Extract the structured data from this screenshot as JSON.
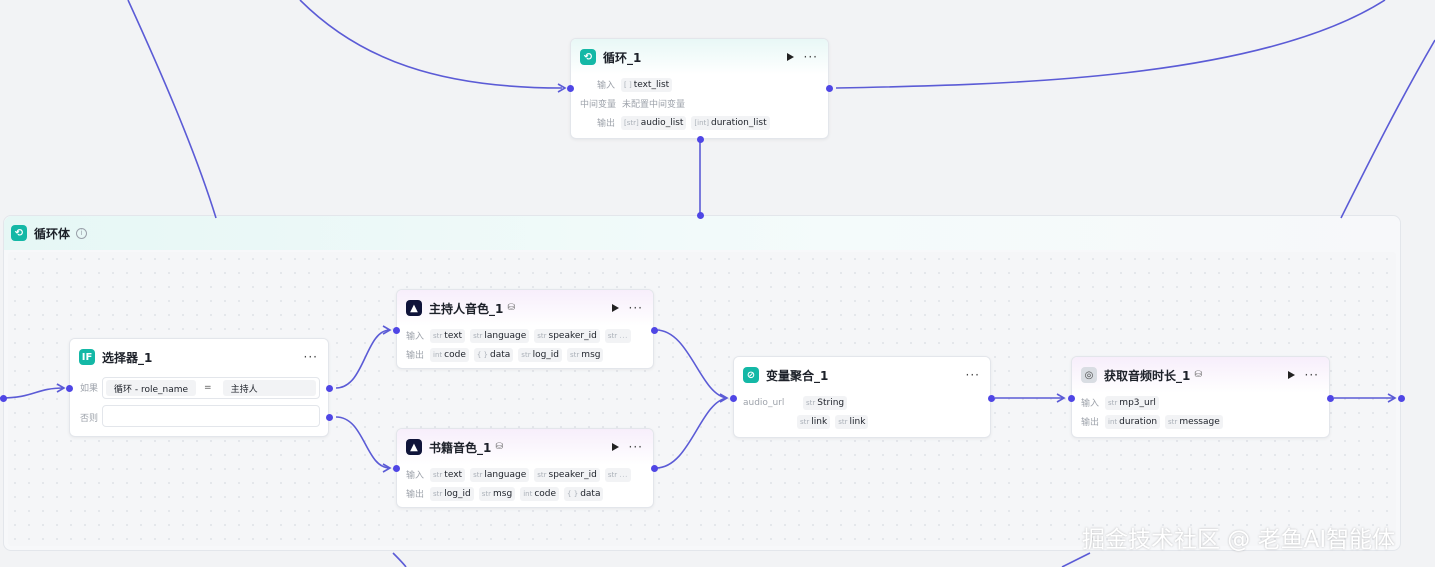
{
  "loop_node": {
    "title": "循环_1",
    "input_label": "输入",
    "input_type": "[ ]",
    "input_value": "text_list",
    "mid_label": "中间变量",
    "mid_value": "未配置中间变量",
    "output_label": "输出",
    "outputs": [
      {
        "type": "[str]",
        "name": "audio_list"
      },
      {
        "type": "[int]",
        "name": "duration_list"
      }
    ]
  },
  "loop_body": {
    "title": "循环体",
    "info_icon": "info-icon"
  },
  "selector_node": {
    "title": "选择器_1",
    "icon_text": "IF",
    "if_label": "如果",
    "cond_left": "循环 - role_name",
    "cond_op": "=",
    "cond_right": "主持人",
    "else_label": "否则"
  },
  "host_voice_node": {
    "title": "主持人音色_1",
    "input_label": "输入",
    "inputs": [
      {
        "type": "str",
        "name": "text"
      },
      {
        "type": "str",
        "name": "language"
      },
      {
        "type": "str",
        "name": "speaker_id"
      },
      {
        "type": "str",
        "name": "..."
      }
    ],
    "output_label": "输出",
    "outputs": [
      {
        "type": "int",
        "name": "code"
      },
      {
        "type": "{ }",
        "name": "data"
      },
      {
        "type": "str",
        "name": "log_id"
      },
      {
        "type": "str",
        "name": "msg"
      }
    ]
  },
  "book_voice_node": {
    "title": "书籍音色_1",
    "input_label": "输入",
    "inputs": [
      {
        "type": "str",
        "name": "text"
      },
      {
        "type": "str",
        "name": "language"
      },
      {
        "type": "str",
        "name": "speaker_id"
      },
      {
        "type": "str",
        "name": "..."
      }
    ],
    "output_label": "输出",
    "outputs": [
      {
        "type": "str",
        "name": "log_id"
      },
      {
        "type": "str",
        "name": "msg"
      },
      {
        "type": "int",
        "name": "code"
      },
      {
        "type": "{ }",
        "name": "data"
      }
    ]
  },
  "merge_node": {
    "title": "变量聚合_1",
    "var_label": "audio_url",
    "var_type": "str",
    "var_value": "String",
    "sources": [
      {
        "type": "str",
        "name": "link"
      },
      {
        "type": "str",
        "name": "link"
      }
    ]
  },
  "duration_node": {
    "title": "获取音频时长_1",
    "input_label": "输入",
    "input": {
      "type": "str",
      "name": "mp3_url"
    },
    "output_label": "输出",
    "outputs": [
      {
        "type": "int",
        "name": "duration"
      },
      {
        "type": "str",
        "name": "message"
      }
    ]
  },
  "watermark": "掘金技术社区 @ 老鱼AI智能体",
  "colors": {
    "wire": "#5b5bd6",
    "port": "#4f46e5",
    "accent_teal": "#14b8a6"
  }
}
